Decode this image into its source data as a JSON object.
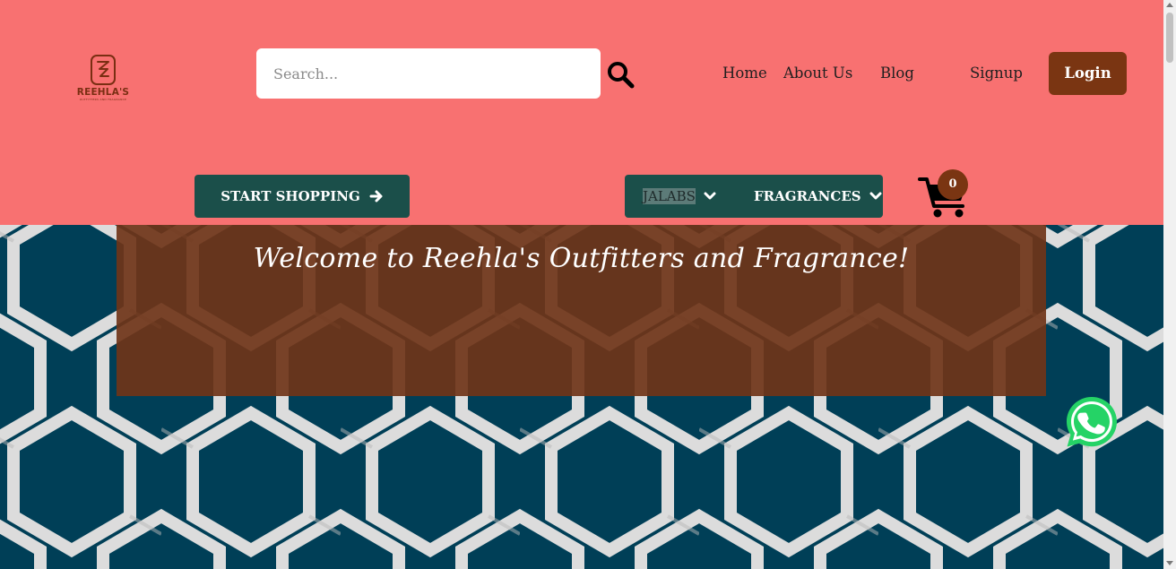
{
  "brand": {
    "logo_text": "REEHLA'S",
    "logo_subtext": "OUTFITTERS AND FRAGRANCE"
  },
  "search": {
    "placeholder": "Search..."
  },
  "nav": {
    "home": "Home",
    "about": "About Us",
    "blog": "Blog",
    "signup": "Signup",
    "login": "Login"
  },
  "actions": {
    "start_shopping": "START SHOPPING"
  },
  "categories": [
    {
      "label": "JALABS"
    },
    {
      "label": "FRAGRANCES"
    }
  ],
  "cart": {
    "count": "0"
  },
  "hero": {
    "welcome": "Welcome to Reehla's Outfitters and Fragrance!"
  },
  "colors": {
    "header_bg": "#f87171",
    "accent_brown": "#7a3512",
    "button_teal": "#1b4f4a",
    "hero_navy": "#003f57",
    "pattern_gray": "#dcdcdc",
    "whatsapp_green": "#25d366"
  },
  "icons": {
    "search": "search-icon",
    "arrow": "arrow-right-icon",
    "chevron": "chevron-down-icon",
    "cart": "shopping-cart-icon",
    "whatsapp": "whatsapp-icon"
  }
}
